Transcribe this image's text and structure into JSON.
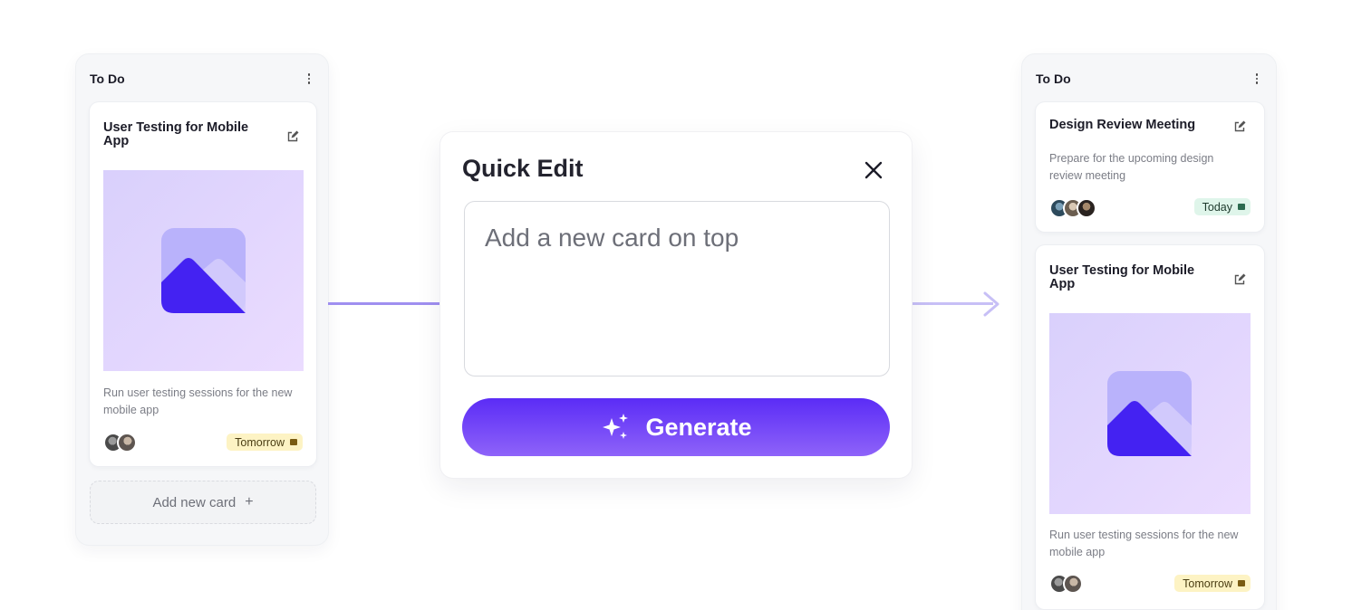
{
  "colors": {
    "accent": "#5b2cf6",
    "accent_light": "#8e63f9",
    "connector": "#9f8ff0",
    "tomorrow_badge_bg": "#fdf3c4",
    "today_badge_bg": "#dff5ea",
    "column_bg": "#f6f7f9"
  },
  "left_column": {
    "title": "To Do",
    "menu_icon": "kebab-menu-icon",
    "card": {
      "title": "User Testing for Mobile App",
      "edit_icon": "edit-icon",
      "image_icon": "image-placeholder-icon",
      "description": "Run user testing sessions for the new mobile app",
      "due_badge": "Tomorrow",
      "avatar_count": 2
    },
    "add_card_label": "Add new card",
    "add_card_icon": "plus-icon"
  },
  "modal": {
    "title": "Quick Edit",
    "close_icon": "close-icon",
    "input_placeholder": "Add a new card on top",
    "input_value": "",
    "generate_label": "Generate",
    "generate_icon": "sparkles-icon"
  },
  "right_column": {
    "title": "To Do",
    "menu_icon": "kebab-menu-icon",
    "cards": [
      {
        "title": "Design Review Meeting",
        "description": "Prepare for the upcoming design review meeting",
        "due_badge": "Today",
        "avatar_count": 3
      },
      {
        "title": "User Testing for Mobile App",
        "description": "Run user testing sessions for the new mobile app",
        "due_badge": "Tomorrow",
        "avatar_count": 2
      }
    ]
  }
}
